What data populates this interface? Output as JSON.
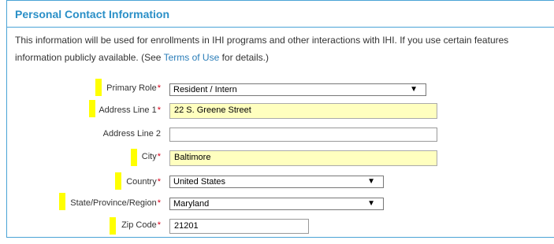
{
  "section": {
    "title": "Personal Contact Information",
    "desc_line1": "This information will be used for enrollments in IHI programs and other interactions with IHI. If you use certain features",
    "desc_line2_pre": "information publicly available. (See ",
    "desc_link": "Terms of Use",
    "desc_line2_post": " for details.)"
  },
  "form": {
    "primary_role": {
      "label": "Primary Role",
      "value": "Resident / Intern"
    },
    "address1": {
      "label": "Address Line 1",
      "value": "22 S. Greene Street"
    },
    "address2": {
      "label": "Address Line 2",
      "value": ""
    },
    "city": {
      "label": "City",
      "value": "Baltimore"
    },
    "country": {
      "label": "Country",
      "value": "United States"
    },
    "state": {
      "label": "State/Province/Region",
      "value": "Maryland"
    },
    "zip": {
      "label": "Zip Code",
      "value": "21201"
    },
    "required_mark": "*"
  },
  "icons": {
    "dropdown": "triangle-down"
  },
  "colors": {
    "accent": "#2a8fc7",
    "highlight": "#ffff00",
    "filled_field": "#ffffbf",
    "required": "#d9001b"
  }
}
